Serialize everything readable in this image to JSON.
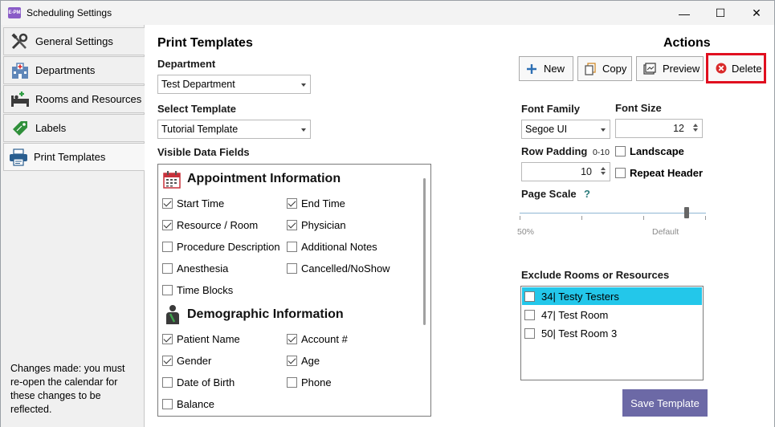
{
  "window": {
    "title": "Scheduling Settings",
    "app_icon_text": "E-PM",
    "minimize_glyph": "—",
    "maximize_glyph": "☐",
    "close_glyph": "✕"
  },
  "sidebar": {
    "items": [
      {
        "label": "General Settings",
        "icon": "tools-icon"
      },
      {
        "label": "Departments",
        "icon": "hospital-icon"
      },
      {
        "label": "Rooms and Resources",
        "icon": "bed-icon"
      },
      {
        "label": "Labels",
        "icon": "tag-icon"
      },
      {
        "label": "Print Templates",
        "icon": "printer-icon"
      }
    ],
    "active_index": 4,
    "note": "Changes made: you must re-open the calendar for these changes to be reflected."
  },
  "main": {
    "title": "Print Templates",
    "department_label": "Department",
    "department_value": "Test Department",
    "template_label": "Select Template",
    "template_value": "Tutorial Template",
    "fields_label": "Visible Data Fields",
    "groups": {
      "appointment": {
        "title": "Appointment Information",
        "icon": "calendar-icon",
        "fields": [
          {
            "label": "Start Time",
            "checked": true
          },
          {
            "label": "End Time",
            "checked": true
          },
          {
            "label": "Resource / Room",
            "checked": true
          },
          {
            "label": "Physician",
            "checked": true
          },
          {
            "label": "Procedure Description",
            "checked": false
          },
          {
            "label": "Additional Notes",
            "checked": false
          },
          {
            "label": "Anesthesia",
            "checked": false
          },
          {
            "label": "Cancelled/NoShow",
            "checked": false
          },
          {
            "label": "Time Blocks",
            "checked": false
          }
        ]
      },
      "demographic": {
        "title": "Demographic Information",
        "icon": "patient-icon",
        "fields": [
          {
            "label": "Patient Name",
            "checked": true
          },
          {
            "label": "Account #",
            "checked": true
          },
          {
            "label": "Gender",
            "checked": true
          },
          {
            "label": "Age",
            "checked": true
          },
          {
            "label": "Date of Birth",
            "checked": false
          },
          {
            "label": "Phone",
            "checked": false
          },
          {
            "label": "Balance",
            "checked": false
          }
        ]
      }
    }
  },
  "actions": {
    "title": "Actions",
    "buttons": {
      "new": "New",
      "copy": "Copy",
      "preview": "Preview",
      "delete": "Delete"
    },
    "font_family_label": "Font Family",
    "font_family_value": "Segoe UI",
    "font_size_label": "Font Size",
    "font_size_value": "12",
    "row_padding_label": "Row Padding",
    "row_padding_range": "0-10",
    "row_padding_value": "10",
    "landscape_label": "Landscape",
    "landscape_checked": false,
    "repeat_header_label": "Repeat Header",
    "repeat_header_checked": false,
    "page_scale_label": "Page Scale",
    "page_scale_help": "?",
    "page_scale_fraction": 0.89,
    "page_scale_min_label": "50%",
    "page_scale_default_label": "Default",
    "exclude_label": "Exclude Rooms or Resources",
    "exclude_items": [
      {
        "label": "34| Testy Testers",
        "checked": false,
        "selected": true
      },
      {
        "label": "47| Test Room",
        "checked": false,
        "selected": false
      },
      {
        "label": "50| Test Room 3",
        "checked": false,
        "selected": false
      }
    ],
    "save_label": "Save Template"
  },
  "colors": {
    "delete_highlight": "#e00f1f",
    "selected_row": "#23c7ea",
    "save_button": "#6c69a6"
  }
}
